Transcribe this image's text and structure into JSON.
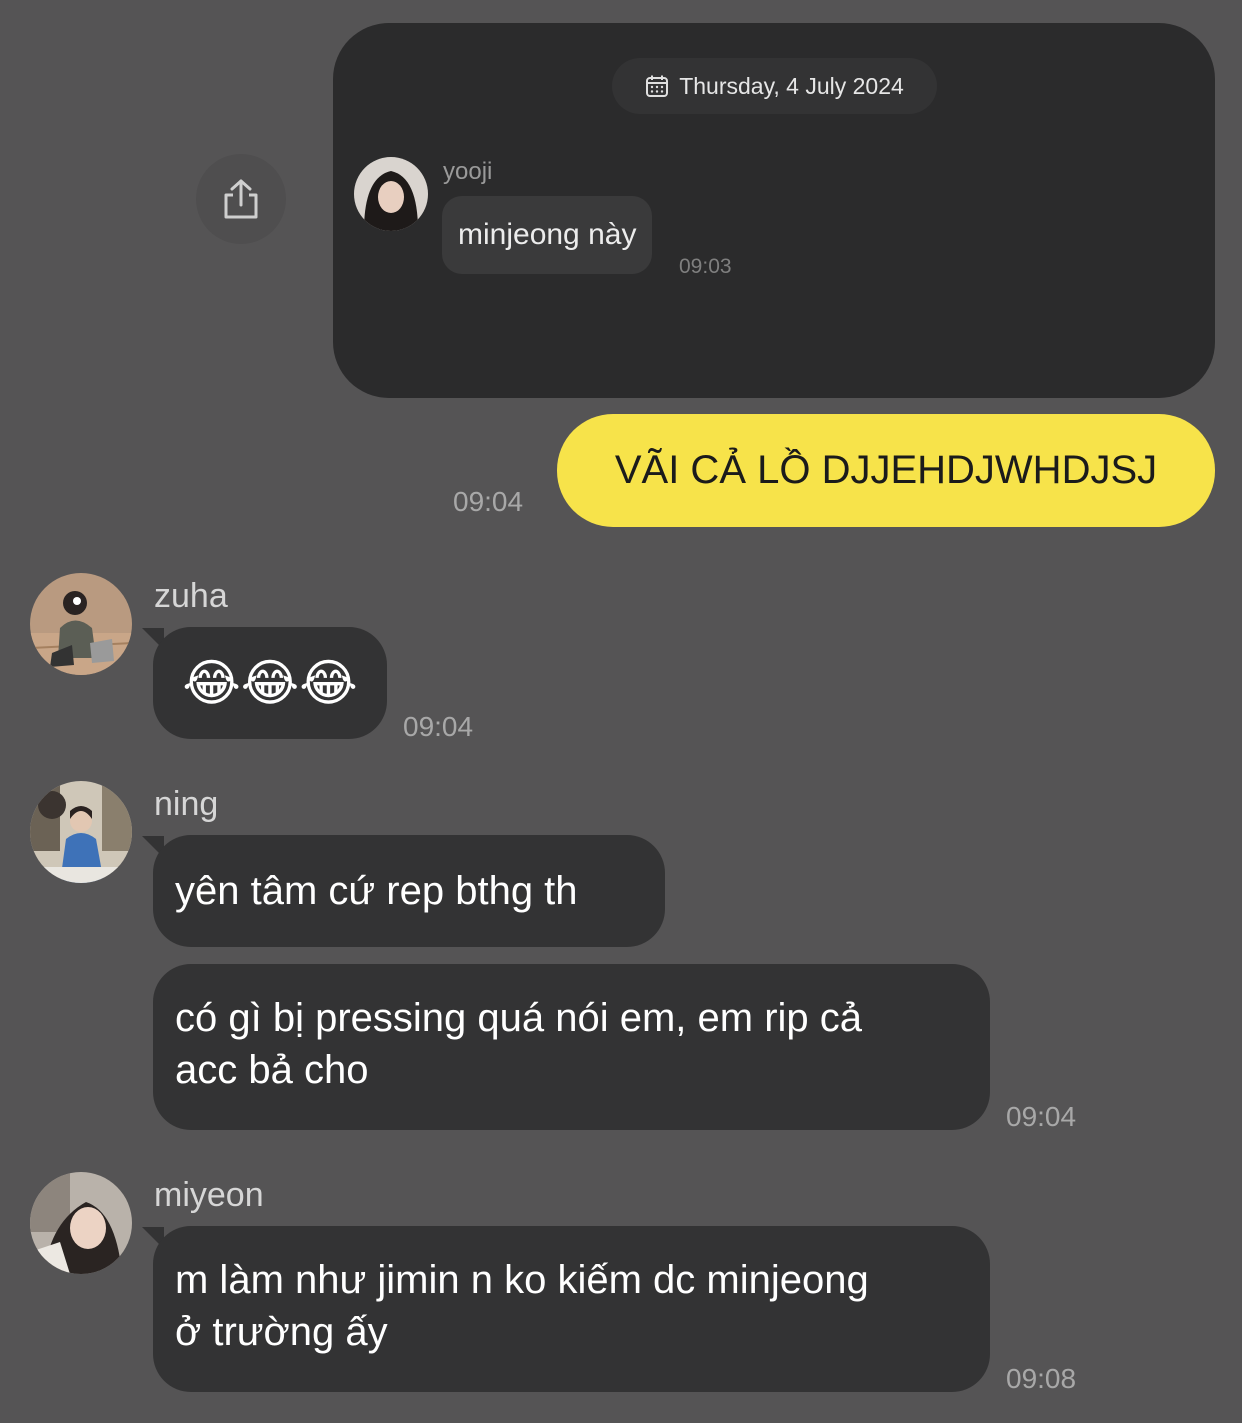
{
  "forwarded": {
    "date": "Thursday, 4 July 2024",
    "sender": "yooji",
    "message": "minjeong này",
    "time": "09:03"
  },
  "own_message": {
    "text": "VÃI CẢ LỒ DJJEHDJWHDJSJ",
    "time": "09:04"
  },
  "messages": [
    {
      "sender": "zuha",
      "text": "😂😂😂",
      "time": "09:04"
    },
    {
      "sender": "ning",
      "text": "yên tâm cứ rep bthg th"
    },
    {
      "text_line1": "có gì bị pressing quá nói em, em rip cả",
      "text_line2": "acc bả cho",
      "time": "09:04"
    },
    {
      "sender": "miyeon",
      "text_line1": "m làm như jimin n ko kiếm dc minjeong",
      "text_line2": "ở trường ấy",
      "time": "09:08"
    }
  ],
  "icons": {
    "share": "share-icon",
    "calendar": "calendar-icon"
  },
  "colors": {
    "background": "#555455",
    "card": "#2b2b2c",
    "own_bubble": "#f7e34a",
    "incoming_bubble": "#333334"
  }
}
